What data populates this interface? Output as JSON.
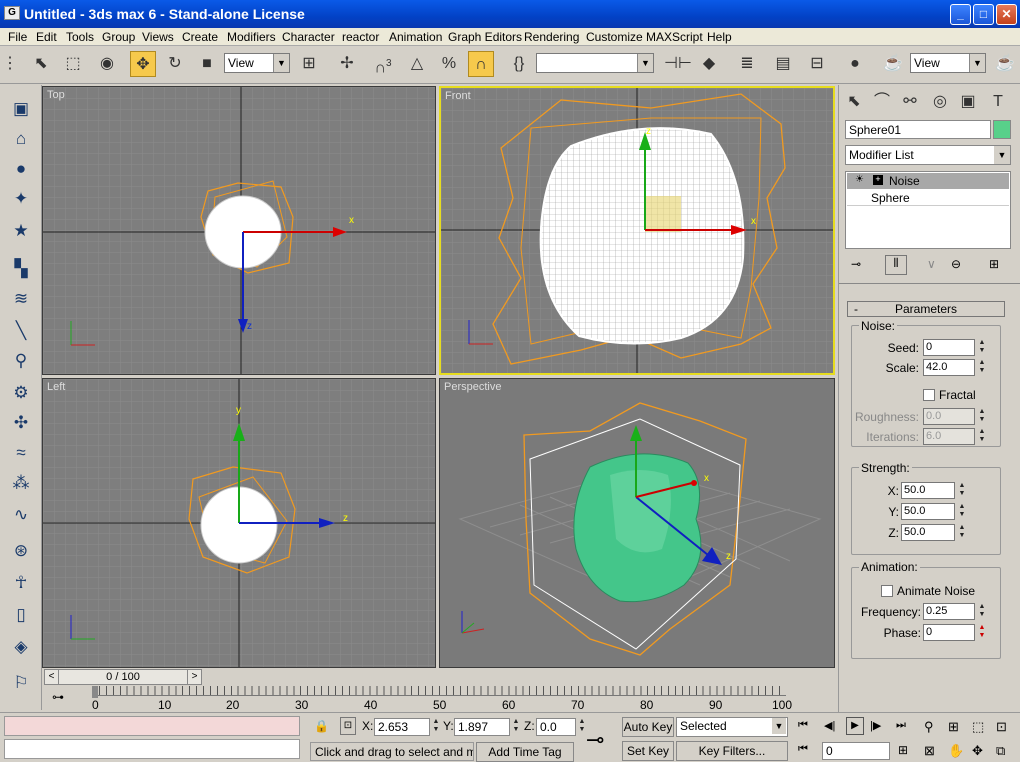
{
  "window": {
    "title": "Untitled - 3ds max 6 - Stand-alone License",
    "minimize": "_",
    "maximize": "□",
    "close": "✕"
  },
  "menu": [
    "File",
    "Edit",
    "Tools",
    "Group",
    "Views",
    "Create",
    "Modifiers",
    "Character",
    "reactor",
    "Animation",
    "Graph Editors",
    "Rendering",
    "Customize",
    "MAXScript",
    "Help"
  ],
  "toolbar": {
    "ref_coord": "View",
    "snaps": "3",
    "selection_set": "",
    "render_type": "View"
  },
  "viewports": {
    "top": "Top",
    "front": "Front",
    "left": "Left",
    "perspective": "Perspective"
  },
  "axes": {
    "x": "x",
    "y": "y",
    "z": "z"
  },
  "timeslider": {
    "value": "0 / 100",
    "left": "<",
    "right": ">"
  },
  "track": {
    "ticks": [
      "0",
      "10",
      "20",
      "30",
      "40",
      "50",
      "60",
      "70",
      "80",
      "90",
      "100"
    ]
  },
  "status": {
    "x_label": "X:",
    "x": "2.653",
    "y_label": "Y:",
    "y": "1.897",
    "z_label": "Z:",
    "z": "0.0",
    "prompt": "Click and drag to select and move",
    "add_time_tag": "Add Time Tag",
    "auto_key": "Auto Key",
    "set_key": "Set Key",
    "key_mode": "Selected",
    "key_filters": "Key Filters...",
    "frame": "0"
  },
  "command_panel": {
    "object_name": "Sphere01",
    "object_color": "#58d08a",
    "modifier_list": "Modifier List",
    "stack": [
      "Noise",
      "Sphere"
    ],
    "parameters": {
      "title": "Parameters",
      "minus": "-",
      "noise_group": "Noise:",
      "seed_label": "Seed:",
      "seed": "0",
      "scale_label": "Scale:",
      "scale": "42.0",
      "fractal": "Fractal",
      "roughness_label": "Roughness:",
      "roughness": "0.0",
      "iterations_label": "Iterations:",
      "iterations": "6.0",
      "strength_group": "Strength:",
      "x_label": "X:",
      "x": "50.0",
      "y_label": "Y:",
      "y": "50.0",
      "z_label": "Z:",
      "z": "50.0",
      "animation_group": "Animation:",
      "animate_noise": "Animate Noise",
      "frequency_label": "Frequency:",
      "frequency": "0.25",
      "phase_label": "Phase:",
      "phase": "0"
    }
  }
}
